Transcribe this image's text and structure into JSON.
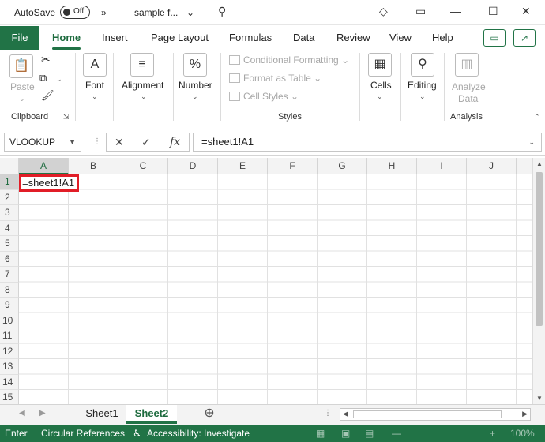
{
  "titlebar": {
    "autosave_label": "AutoSave",
    "autosave_state": "Off",
    "overflow": "»",
    "filename": "sample f...",
    "filename_caret": "⌄"
  },
  "tabs": {
    "file": "File",
    "items": [
      "Home",
      "Insert",
      "Page Layout",
      "Formulas",
      "Data",
      "Review",
      "View",
      "Help"
    ],
    "active": "Home"
  },
  "ribbon": {
    "clipboard": {
      "paste": "Paste",
      "group": "Clipboard"
    },
    "font": {
      "label": "Font"
    },
    "alignment": {
      "label": "Alignment"
    },
    "number": {
      "label": "Number"
    },
    "styles": {
      "conditional": "Conditional Formatting",
      "format_table": "Format as Table",
      "cell_styles": "Cell Styles",
      "group": "Styles"
    },
    "cells": {
      "label": "Cells"
    },
    "editing": {
      "label": "Editing"
    },
    "analysis": {
      "analyze_line1": "Analyze",
      "analyze_line2": "Data",
      "group": "Analysis"
    }
  },
  "formula_bar": {
    "name_box": "VLOOKUP",
    "cancel": "✕",
    "enter": "✓",
    "fx": "fx",
    "formula": "=sheet1!A1"
  },
  "grid": {
    "columns": [
      "A",
      "B",
      "C",
      "D",
      "E",
      "F",
      "G",
      "H",
      "I",
      "J"
    ],
    "rows": [
      "1",
      "2",
      "3",
      "4",
      "5",
      "6",
      "7",
      "8",
      "9",
      "10",
      "11",
      "12",
      "13",
      "14",
      "15"
    ],
    "active_cell_value": "=sheet1!A1"
  },
  "sheets": {
    "tabs": [
      "Sheet1",
      "Sheet2"
    ],
    "active": "Sheet2",
    "add": "⊕"
  },
  "status": {
    "mode": "Enter",
    "circular": "Circular References",
    "accessibility": "Accessibility: Investigate",
    "zoom": "100%"
  },
  "colors": {
    "accent": "#217346",
    "highlight": "#e11d27"
  }
}
